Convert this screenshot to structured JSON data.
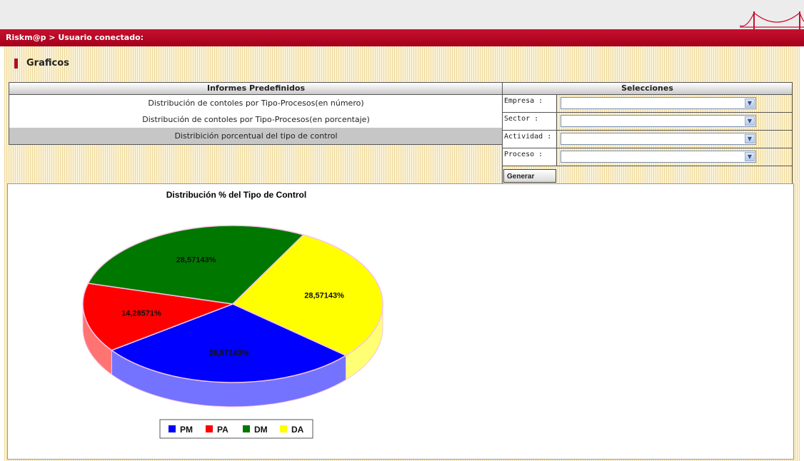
{
  "header": {
    "breadcrumb": "Riskm@p > Usuario conectado:"
  },
  "page": {
    "title": "Graficos"
  },
  "reports": {
    "header": "Informes Predefinidos",
    "items": [
      {
        "label": "Distribución de contoles por Tipo-Procesos(en número)",
        "selected": false
      },
      {
        "label": "Distribución de contoles por Tipo-Procesos(en porcentaje)",
        "selected": false
      },
      {
        "label": "Distribición porcentual del tipo de control",
        "selected": true
      }
    ]
  },
  "selections": {
    "header": "Selecciones",
    "fields": [
      {
        "label": "Empresa :",
        "value": ""
      },
      {
        "label": "Sector :",
        "value": ""
      },
      {
        "label": "Actividad :",
        "value": ""
      },
      {
        "label": "Proceso :",
        "value": ""
      }
    ],
    "generate_label": "Generar"
  },
  "chart_data": {
    "type": "pie",
    "title": "Distribución % del Tipo de Control",
    "slices": [
      {
        "name": "PM",
        "value": 28.57143,
        "label": "28,57143%",
        "color": "#0000ff"
      },
      {
        "name": "PA",
        "value": 14.28571,
        "label": "14,28571%",
        "color": "#ff0000"
      },
      {
        "name": "DM",
        "value": 28.57143,
        "label": "28,57143%",
        "color": "#007800"
      },
      {
        "name": "DA",
        "value": 28.57143,
        "label": "28,57143%",
        "color": "#ffff00"
      }
    ],
    "legend": {
      "placement": "bottom"
    }
  }
}
